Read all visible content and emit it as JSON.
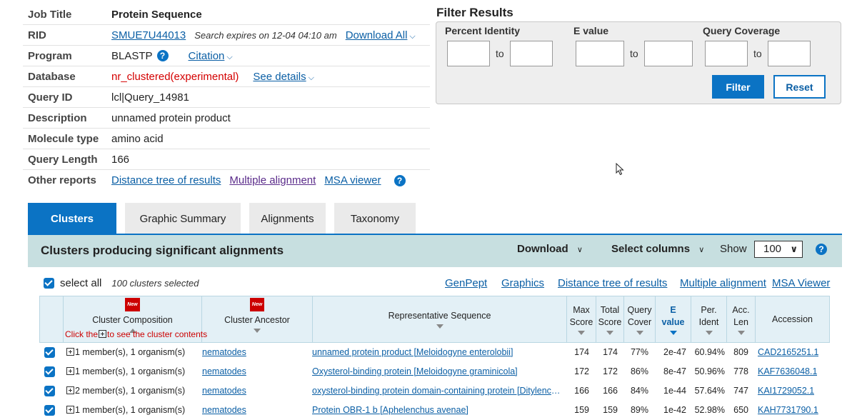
{
  "summary": {
    "job_title_label": "Job Title",
    "job_title": "Protein Sequence",
    "rid_label": "RID",
    "rid": "SMUE7U44013",
    "rid_expiry": "Search expires on 12-04 04:10 am",
    "download_all": "Download All",
    "program_label": "Program",
    "program": "BLASTP",
    "citation": "Citation",
    "database_label": "Database",
    "database": "nr_clustered(experimental)",
    "see_details": "See details",
    "query_id_label": "Query ID",
    "query_id": "lcl|Query_14981",
    "description_label": "Description",
    "description": "unnamed protein product",
    "molecule_label": "Molecule type",
    "molecule": "amino acid",
    "query_length_label": "Query Length",
    "query_length": "166",
    "other_reports_label": "Other reports",
    "other_reports": [
      "Distance tree of results",
      "Multiple alignment",
      "MSA viewer"
    ]
  },
  "filter": {
    "title": "Filter Results",
    "groups": [
      "Percent Identity",
      "E value",
      "Query Coverage"
    ],
    "to": "to",
    "filter_btn": "Filter",
    "reset_btn": "Reset"
  },
  "tabs": [
    "Clusters",
    "Graphic Summary",
    "Alignments",
    "Taxonomy"
  ],
  "results": {
    "title": "Clusters producing significant alignments",
    "download": "Download",
    "select_columns": "Select columns",
    "show": "Show",
    "show_value": "100",
    "select_all": "select all",
    "selected_count": "100 clusters selected",
    "links": [
      "GenPept",
      "Graphics",
      "Distance tree of results",
      "Multiple alignment",
      "MSA Viewer"
    ]
  },
  "columns": {
    "new_badge": "New",
    "cluster_composition": "Cluster Composition",
    "click_hint_pre": "Click the",
    "click_hint_post": "to see the cluster contents",
    "cluster_ancestor": "Cluster Ancestor",
    "representative": "Representative Sequence",
    "max1": "Max",
    "max2": "Score",
    "total1": "Total",
    "total2": "Score",
    "query1": "Query",
    "query2": "Cover",
    "e1": "E",
    "e2": "value",
    "per1": "Per.",
    "per2": "Ident",
    "acc1": "Acc.",
    "acc2": "Len",
    "accession": "Accession"
  },
  "rows": [
    {
      "comp": "1 member(s), 1 organism(s)",
      "ancestor": "nematodes",
      "rep": "unnamed protein product [Meloidogyne enterolobii]",
      "max": "174",
      "total": "174",
      "cover": "77%",
      "e": "2e-47",
      "ident": "60.94%",
      "len": "809",
      "acc": "CAD2165251.1"
    },
    {
      "comp": "1 member(s), 1 organism(s)",
      "ancestor": "nematodes",
      "rep": "Oxysterol-binding protein [Meloidogyne graminicola]",
      "max": "172",
      "total": "172",
      "cover": "86%",
      "e": "8e-47",
      "ident": "50.96%",
      "len": "778",
      "acc": "KAF7636048.1"
    },
    {
      "comp": "2 member(s), 1 organism(s)",
      "ancestor": "nematodes",
      "rep": "oxysterol-binding protein domain-containing protein [Ditylenchus destructor]",
      "max": "166",
      "total": "166",
      "cover": "84%",
      "e": "1e-44",
      "ident": "57.64%",
      "len": "747",
      "acc": "KAI1729052.1"
    },
    {
      "comp": "1 member(s), 1 organism(s)",
      "ancestor": "nematodes",
      "rep": "Protein OBR-1 b [Aphelenchus avenae]",
      "max": "159",
      "total": "159",
      "cover": "89%",
      "e": "1e-42",
      "ident": "52.98%",
      "len": "650",
      "acc": "KAH7731790.1"
    }
  ]
}
